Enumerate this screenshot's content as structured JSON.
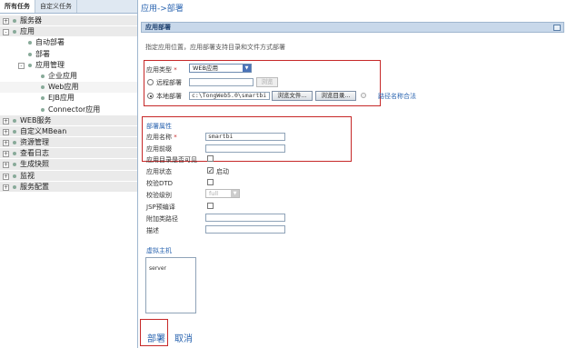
{
  "tabs": [
    "所有任务",
    "自定义任务"
  ],
  "tree": [
    {
      "label": "服务器",
      "level": 0,
      "expander": "+"
    },
    {
      "label": "应用",
      "level": 0,
      "expander": "-"
    },
    {
      "label": "自动部署",
      "level": 1,
      "expander": ""
    },
    {
      "label": "部署",
      "level": 1,
      "expander": ""
    },
    {
      "label": "应用管理",
      "level": 1,
      "expander": "-"
    },
    {
      "label": "企业应用",
      "level": 2,
      "expander": ""
    },
    {
      "label": "Web应用",
      "level": 2,
      "expander": ""
    },
    {
      "label": "EJB应用",
      "level": 2,
      "expander": ""
    },
    {
      "label": "Connector应用",
      "level": 2,
      "expander": ""
    },
    {
      "label": "WEB服务",
      "level": 0,
      "expander": "+"
    },
    {
      "label": "自定义MBean",
      "level": 0,
      "expander": "+"
    },
    {
      "label": "资源管理",
      "level": 0,
      "expander": "+"
    },
    {
      "label": "查看日志",
      "level": 0,
      "expander": "+"
    },
    {
      "label": "生成快照",
      "level": 0,
      "expander": "+"
    },
    {
      "label": "监视",
      "level": 0,
      "expander": "+"
    },
    {
      "label": "服务配置",
      "level": 0,
      "expander": "+"
    }
  ],
  "breadcrumb": "应用->部署",
  "panel_title": "应用部署",
  "hint": "指定应用位置，应用部署支持目录和文件方式部署",
  "app_type": {
    "label": "应用类型",
    "required": "*",
    "value": "WEB应用"
  },
  "remote_deploy": {
    "label": "远程部署",
    "button": "浏览"
  },
  "local_deploy": {
    "label": "本地部署",
    "path": "c:\\TongWeb5.0\\smartbi",
    "browse_file": "浏览文件...",
    "browse_dir": "浏览目录...",
    "link": "路径名称合法"
  },
  "deploy_props": {
    "title": "部署属性",
    "app_name_label": "应用名称",
    "app_name_required": "*",
    "app_name_value": "smartbi",
    "prefix_label": "应用前缀",
    "dir_visible_label": "应用目录是否可见",
    "status_label": "应用状态",
    "status_text": "启动",
    "dtd_label": "校验DTD",
    "level_label": "校验级别",
    "level_value": "full",
    "jsp_label": "JSP预编译",
    "classpath_label": "附加类路径",
    "desc_label": "描述"
  },
  "virtual_host": {
    "title": "虚拟主机",
    "items": [
      "server"
    ]
  },
  "actions": {
    "deploy": "部署",
    "cancel": "取消"
  },
  "colors": {
    "highlight": "#c62828",
    "link": "#2a64b0",
    "header": "#c8d8ea"
  }
}
